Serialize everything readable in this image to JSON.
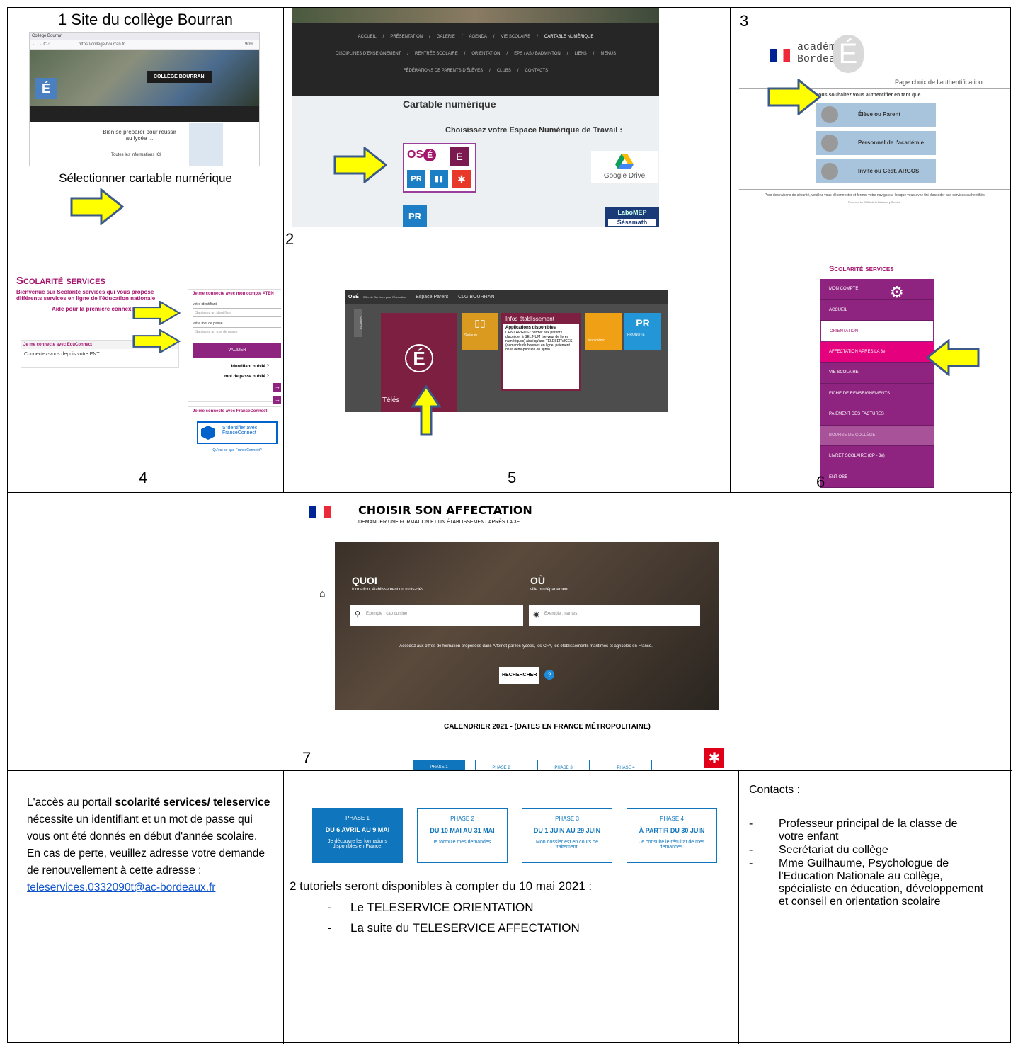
{
  "cell1": {
    "title": "1 Site du collège Bourran",
    "caption": "Sélectionner cartable numérique",
    "shot": {
      "browser_tab": "Collège Bourran",
      "url": "https://college-bourran.fr",
      "zoom": "90%",
      "banner": "COLLÈGE BOURRAN",
      "headline": "Bien se préparer pour réussir au lycée ...",
      "link": "Toutes les informations ICI"
    }
  },
  "cell2": {
    "number": "2",
    "nav1": [
      "ACCUEIL",
      "PRÉSENTATION",
      "GALERIE",
      "AGENDA",
      "VIE SCOLAIRE",
      "CARTABLE NUMÉRIQUE"
    ],
    "nav2": [
      "DISCIPLINES D'ENSEIGNEMENT",
      "RENTRÉE SCOLAIRE",
      "ORIENTATION",
      "EPS / AS / BADMINTON",
      "LIENS",
      "MENUS"
    ],
    "nav3": [
      "FÉDÉRATIONS DE PARENTS D'ÉLÈVES",
      "CLUBS",
      "CONTACTS"
    ],
    "heading": "Cartable numérique",
    "subheading": "Choisissez votre Espace Numérique de Travail :",
    "drive": "Google Drive",
    "labomep": "LaboMEP",
    "sesamath": "Sésamath"
  },
  "cell3": {
    "number": "3",
    "academie": "académie",
    "bordeaux": "Bordeaux",
    "page_title": "Page choix de l'authentification",
    "prompt": "Vous souhaitez vous authentifier en tant que",
    "buttons": [
      "Élève ou Parent",
      "Personnel de l'académie",
      "Invité ou Gest. ARGOS"
    ],
    "footer": "Pour des raisons de sécurité, veuillez vous déconnecter et fermer votre navigateur lorsque vous avez fini d'accéder aux services authentifiés.",
    "powered": "Powered by Shibboleth Discovery Service"
  },
  "cell4": {
    "number": "4",
    "brand": "Scolarité services",
    "welcome": "Bienvenue sur Scolarité services qui vous propose différents services en ligne de l'éducation nationale",
    "help": "Aide pour la première connexion de parents",
    "educonnect_title": "Je me connecte avec EduConnect",
    "educonnect_text": "Connectez-vous depuis votre ENT",
    "aten_title": "Je me connecte avec mon compte ATEN",
    "id_label": "votre identifiant",
    "id_placeholder": "Saisissez un identifiant",
    "pw_label": "votre mot de passe",
    "pw_placeholder": "Saisissez un mot de passe",
    "validate": "VALIDER",
    "forgot_id": "identifiant oublié ?",
    "forgot_pw": "mot de passe oublié ?",
    "fc_title": "Je me connecte avec FranceConnect",
    "fc_button": "S'identifier avec FranceConnect",
    "fc_link": "Qu'est-ce que FranceConnect?"
  },
  "cell5": {
    "number": "5",
    "topbar": "Offre de Services pour l'Éducation",
    "espace": "Espace Parent",
    "school": "CLG BOURRAN",
    "side": "Services",
    "tele": "Télés",
    "selinum": "Selinum",
    "info_title": "Infos établissement",
    "info_heading": "Applications disponibles",
    "info_text": "L'ENT ARGOS2 permet aux parents d'accéder à SELINUM (serveur de livres numériques) ainsi qu'aux TELESERVICES (demande de bourses en ligne, paiement de la demi-pension en ligne).",
    "memo": "Mon mémo",
    "pronote": "PRONOTE"
  },
  "cell6": {
    "number": "6",
    "brand": "Scolarité services",
    "menu": [
      "MON COMPTE",
      "ACCUEIL",
      "ORIENTATION",
      "AFFECTATION APRÈS LA 3e",
      "VIE SCOLAIRE",
      "FICHE DE RENSEIGNEMENTS",
      "PAIEMENT DES FACTURES",
      "BOURSE DE COLLÈGE",
      "LIVRET SCOLAIRE (CP - 3e)",
      "ENT OSÉ"
    ]
  },
  "cell7": {
    "number": "7",
    "title": "CHOISIR SON AFFECTATION",
    "subtitle": "DEMANDER UNE FORMATION ET UN ÉTABLISSEMENT APRÈS LA 3E",
    "quoi": "QUOI",
    "quoi_sub": "formation, établissement ou mots-clés",
    "ou": "OÙ",
    "ou_sub": "ville ou département",
    "quoi_placeholder": "Exemple : cap cuisine",
    "ou_placeholder": "Exemple : nantes",
    "info": "Accédez aux offres de formation proposées dans Affelnet par les lycées, les CFA, les établissements maritimes et agricoles en France.",
    "search": "RECHERCHER",
    "calendar": "CALENDRIER 2021 - (DATES EN FRANCE MÉTROPOLITAINE)",
    "phases": [
      "PHASE 1",
      "PHASE 2",
      "PHASE 3",
      "PHASE 4"
    ]
  },
  "bottom_left": {
    "t1": "L'accès au portail ",
    "bold1": "scolarité services/ teleservice",
    "t2": " nécessite un identifiant et un mot de passe qui vous ont été donnés en début d'année scolaire.",
    "t3": "En cas de perte, veuillez adresse votre demande de renouvellement à cette adresse :",
    "email": "teleservices.0332090t@ac-bordeaux.fr"
  },
  "bottom_mid": {
    "phases": [
      {
        "label": "PHASE 1",
        "dates": "DU 6 AVRIL AU 9 MAI",
        "desc": "Je découvre les formations disponibles en France."
      },
      {
        "label": "PHASE 2",
        "dates": "DU 10 MAI AU 31 MAI",
        "desc": "Je formule mes demandes."
      },
      {
        "label": "PHASE 3",
        "dates": "DU 1 JUIN AU 29 JUIN",
        "desc": "Mon dossier est en cours de traitement."
      },
      {
        "label": "PHASE 4",
        "dates": "À PARTIR DU 30 JUIN",
        "desc": "Je consulte le résultat de mes demandes."
      }
    ],
    "tutorials": "2  tutoriels seront disponibles à compter du 10 mai  2021 :",
    "items": [
      "Le TELESERVICE ORIENTATION",
      "La suite du TELESERVICE AFFECTATION"
    ]
  },
  "bottom_right": {
    "title": "Contacts :",
    "items": [
      "Professeur principal de la classe de votre enfant",
      "Secrétariat du collège",
      "Mme Guilhaume, Psychologue de l'Education Nationale au collège, spécialiste en éducation, développement et conseil en orientation scolaire"
    ]
  },
  "colors": {
    "arrow": "#ffff00",
    "arrow_border": "#3b5a8a",
    "magenta": "#a4156e",
    "pink": "#e5007e",
    "blue": "#0f75bc"
  }
}
